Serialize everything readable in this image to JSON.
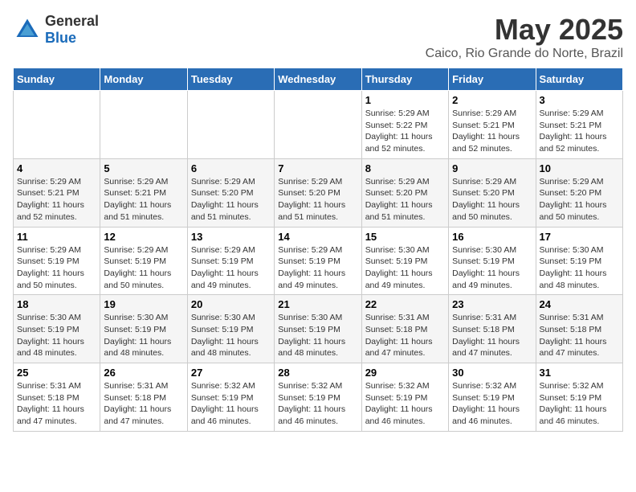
{
  "logo": {
    "general": "General",
    "blue": "Blue"
  },
  "title": "May 2025",
  "location": "Caico, Rio Grande do Norte, Brazil",
  "days_of_week": [
    "Sunday",
    "Monday",
    "Tuesday",
    "Wednesday",
    "Thursday",
    "Friday",
    "Saturday"
  ],
  "weeks": [
    [
      {
        "day": "",
        "info": ""
      },
      {
        "day": "",
        "info": ""
      },
      {
        "day": "",
        "info": ""
      },
      {
        "day": "",
        "info": ""
      },
      {
        "day": "1",
        "sunrise": "Sunrise: 5:29 AM",
        "sunset": "Sunset: 5:22 PM",
        "daylight": "Daylight: 11 hours and 52 minutes."
      },
      {
        "day": "2",
        "sunrise": "Sunrise: 5:29 AM",
        "sunset": "Sunset: 5:21 PM",
        "daylight": "Daylight: 11 hours and 52 minutes."
      },
      {
        "day": "3",
        "sunrise": "Sunrise: 5:29 AM",
        "sunset": "Sunset: 5:21 PM",
        "daylight": "Daylight: 11 hours and 52 minutes."
      }
    ],
    [
      {
        "day": "4",
        "sunrise": "Sunrise: 5:29 AM",
        "sunset": "Sunset: 5:21 PM",
        "daylight": "Daylight: 11 hours and 52 minutes."
      },
      {
        "day": "5",
        "sunrise": "Sunrise: 5:29 AM",
        "sunset": "Sunset: 5:21 PM",
        "daylight": "Daylight: 11 hours and 51 minutes."
      },
      {
        "day": "6",
        "sunrise": "Sunrise: 5:29 AM",
        "sunset": "Sunset: 5:20 PM",
        "daylight": "Daylight: 11 hours and 51 minutes."
      },
      {
        "day": "7",
        "sunrise": "Sunrise: 5:29 AM",
        "sunset": "Sunset: 5:20 PM",
        "daylight": "Daylight: 11 hours and 51 minutes."
      },
      {
        "day": "8",
        "sunrise": "Sunrise: 5:29 AM",
        "sunset": "Sunset: 5:20 PM",
        "daylight": "Daylight: 11 hours and 51 minutes."
      },
      {
        "day": "9",
        "sunrise": "Sunrise: 5:29 AM",
        "sunset": "Sunset: 5:20 PM",
        "daylight": "Daylight: 11 hours and 50 minutes."
      },
      {
        "day": "10",
        "sunrise": "Sunrise: 5:29 AM",
        "sunset": "Sunset: 5:20 PM",
        "daylight": "Daylight: 11 hours and 50 minutes."
      }
    ],
    [
      {
        "day": "11",
        "sunrise": "Sunrise: 5:29 AM",
        "sunset": "Sunset: 5:19 PM",
        "daylight": "Daylight: 11 hours and 50 minutes."
      },
      {
        "day": "12",
        "sunrise": "Sunrise: 5:29 AM",
        "sunset": "Sunset: 5:19 PM",
        "daylight": "Daylight: 11 hours and 50 minutes."
      },
      {
        "day": "13",
        "sunrise": "Sunrise: 5:29 AM",
        "sunset": "Sunset: 5:19 PM",
        "daylight": "Daylight: 11 hours and 49 minutes."
      },
      {
        "day": "14",
        "sunrise": "Sunrise: 5:29 AM",
        "sunset": "Sunset: 5:19 PM",
        "daylight": "Daylight: 11 hours and 49 minutes."
      },
      {
        "day": "15",
        "sunrise": "Sunrise: 5:30 AM",
        "sunset": "Sunset: 5:19 PM",
        "daylight": "Daylight: 11 hours and 49 minutes."
      },
      {
        "day": "16",
        "sunrise": "Sunrise: 5:30 AM",
        "sunset": "Sunset: 5:19 PM",
        "daylight": "Daylight: 11 hours and 49 minutes."
      },
      {
        "day": "17",
        "sunrise": "Sunrise: 5:30 AM",
        "sunset": "Sunset: 5:19 PM",
        "daylight": "Daylight: 11 hours and 48 minutes."
      }
    ],
    [
      {
        "day": "18",
        "sunrise": "Sunrise: 5:30 AM",
        "sunset": "Sunset: 5:19 PM",
        "daylight": "Daylight: 11 hours and 48 minutes."
      },
      {
        "day": "19",
        "sunrise": "Sunrise: 5:30 AM",
        "sunset": "Sunset: 5:19 PM",
        "daylight": "Daylight: 11 hours and 48 minutes."
      },
      {
        "day": "20",
        "sunrise": "Sunrise: 5:30 AM",
        "sunset": "Sunset: 5:19 PM",
        "daylight": "Daylight: 11 hours and 48 minutes."
      },
      {
        "day": "21",
        "sunrise": "Sunrise: 5:30 AM",
        "sunset": "Sunset: 5:19 PM",
        "daylight": "Daylight: 11 hours and 48 minutes."
      },
      {
        "day": "22",
        "sunrise": "Sunrise: 5:31 AM",
        "sunset": "Sunset: 5:18 PM",
        "daylight": "Daylight: 11 hours and 47 minutes."
      },
      {
        "day": "23",
        "sunrise": "Sunrise: 5:31 AM",
        "sunset": "Sunset: 5:18 PM",
        "daylight": "Daylight: 11 hours and 47 minutes."
      },
      {
        "day": "24",
        "sunrise": "Sunrise: 5:31 AM",
        "sunset": "Sunset: 5:18 PM",
        "daylight": "Daylight: 11 hours and 47 minutes."
      }
    ],
    [
      {
        "day": "25",
        "sunrise": "Sunrise: 5:31 AM",
        "sunset": "Sunset: 5:18 PM",
        "daylight": "Daylight: 11 hours and 47 minutes."
      },
      {
        "day": "26",
        "sunrise": "Sunrise: 5:31 AM",
        "sunset": "Sunset: 5:18 PM",
        "daylight": "Daylight: 11 hours and 47 minutes."
      },
      {
        "day": "27",
        "sunrise": "Sunrise: 5:32 AM",
        "sunset": "Sunset: 5:19 PM",
        "daylight": "Daylight: 11 hours and 46 minutes."
      },
      {
        "day": "28",
        "sunrise": "Sunrise: 5:32 AM",
        "sunset": "Sunset: 5:19 PM",
        "daylight": "Daylight: 11 hours and 46 minutes."
      },
      {
        "day": "29",
        "sunrise": "Sunrise: 5:32 AM",
        "sunset": "Sunset: 5:19 PM",
        "daylight": "Daylight: 11 hours and 46 minutes."
      },
      {
        "day": "30",
        "sunrise": "Sunrise: 5:32 AM",
        "sunset": "Sunset: 5:19 PM",
        "daylight": "Daylight: 11 hours and 46 minutes."
      },
      {
        "day": "31",
        "sunrise": "Sunrise: 5:32 AM",
        "sunset": "Sunset: 5:19 PM",
        "daylight": "Daylight: 11 hours and 46 minutes."
      }
    ]
  ]
}
